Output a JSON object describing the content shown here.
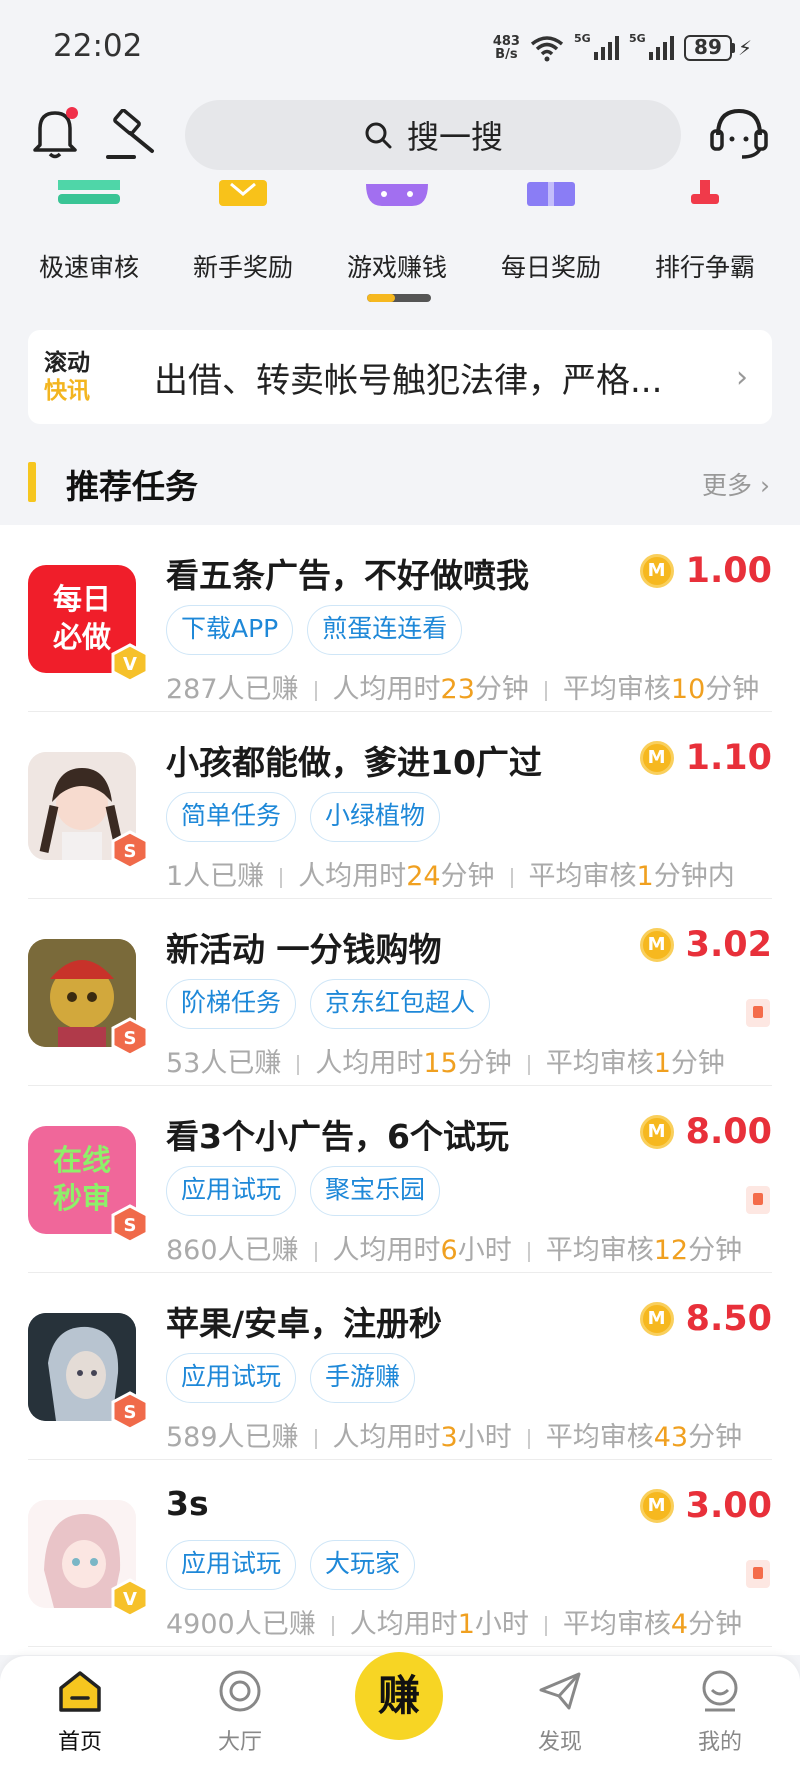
{
  "status_bar": {
    "time": "22:02",
    "net_speed_value": "483",
    "net_speed_unit": "B/s",
    "sim1": "5G",
    "sim2": "5G",
    "battery": "89"
  },
  "header": {
    "search_placeholder": "搜一搜"
  },
  "quick_menu": [
    {
      "label": "极速审核",
      "icon": "fast-review-icon"
    },
    {
      "label": "新手奖励",
      "icon": "newbie-reward-icon"
    },
    {
      "label": "游戏赚钱",
      "icon": "game-money-icon"
    },
    {
      "label": "每日奖励",
      "icon": "daily-reward-icon"
    },
    {
      "label": "排行争霸",
      "icon": "ranking-icon"
    }
  ],
  "news": {
    "badge_line1": "滚动",
    "badge_line2": "快讯",
    "message": "出借、转卖帐号触犯法律，严格..."
  },
  "section": {
    "title": "推荐任务",
    "more": "更多"
  },
  "tasks": [
    {
      "title": "看五条广告，不好做喷我",
      "reward": "1.00",
      "tags": [
        "下载APP",
        "煎蛋连连看"
      ],
      "earned": "287人已赚",
      "avg_prefix": "人均用时",
      "avg_value": "23",
      "avg_unit": "分钟",
      "review_prefix": "平均审核",
      "review_value": "10",
      "review_unit": "分钟",
      "thumb_text": "每日必做",
      "level": "V"
    },
    {
      "title": "小孩都能做，爹进10广过",
      "reward": "1.10",
      "tags": [
        "简单任务",
        "小绿植物"
      ],
      "earned": "1人已赚",
      "avg_prefix": "人均用时",
      "avg_value": "24",
      "avg_unit": "分钟",
      "review_prefix": "平均审核",
      "review_value": "1",
      "review_unit": "分钟内",
      "level": "S"
    },
    {
      "title": "新活动 一分钱购物",
      "reward": "3.02",
      "tags": [
        "阶梯任务",
        "京东红包超人"
      ],
      "earned": "53人已赚",
      "avg_prefix": "人均用时",
      "avg_value": "15",
      "avg_unit": "分钟",
      "review_prefix": "平均审核",
      "review_value": "1",
      "review_unit": "分钟",
      "level": "S"
    },
    {
      "title": "看3个小广告，6个试玩",
      "reward": "8.00",
      "tags": [
        "应用试玩",
        "聚宝乐园"
      ],
      "earned": "860人已赚",
      "avg_prefix": "人均用时",
      "avg_value": "6",
      "avg_unit": "小时",
      "review_prefix": "平均审核",
      "review_value": "12",
      "review_unit": "分钟",
      "thumb_text": "在线秒审",
      "level": "S"
    },
    {
      "title": "苹果/安卓，注册秒",
      "reward": "8.50",
      "tags": [
        "应用试玩",
        "手游赚"
      ],
      "earned": "589人已赚",
      "avg_prefix": "人均用时",
      "avg_value": "3",
      "avg_unit": "小时",
      "review_prefix": "平均审核",
      "review_value": "43",
      "review_unit": "分钟",
      "level": "S"
    },
    {
      "title": "3s",
      "reward": "3.00",
      "tags": [
        "应用试玩",
        "大玩家"
      ],
      "earned": "4900人已赚",
      "avg_prefix": "人均用时",
      "avg_value": "1",
      "avg_unit": "小时",
      "review_prefix": "平均审核",
      "review_value": "4",
      "review_unit": "分钟",
      "level": "V"
    }
  ],
  "tabbar": {
    "home": "首页",
    "hall": "大厅",
    "earn": "赚",
    "discover": "发现",
    "mine": "我的"
  },
  "colors": {
    "accent": "#f6c61f",
    "reward": "#e8303a",
    "tag": "#1e88d8",
    "highlight": "#f0a020"
  }
}
